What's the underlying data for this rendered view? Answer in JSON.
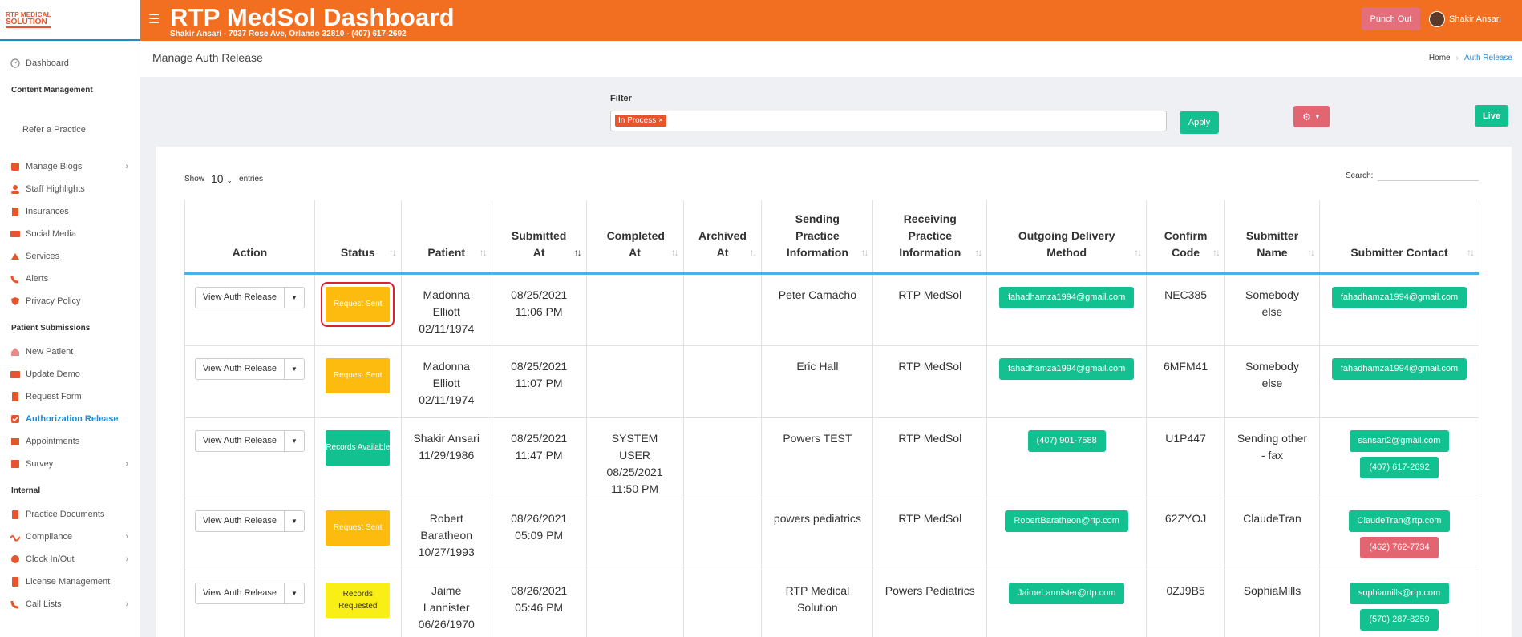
{
  "brand": {
    "logo_line1": "RTP MEDICAL",
    "logo_line2": "SOLUTION"
  },
  "header": {
    "title": "RTP MedSol Dashboard",
    "subtitle": "Shakir Ansari - 7037 Rose Ave, Orlando 32810 - (407) 617-2692",
    "punch_out": "Punch Out",
    "user_name": "Shakir Ansari"
  },
  "sidebar": {
    "dashboard": "Dashboard",
    "section_content": "Content Management",
    "refer": "Refer a Practice",
    "content_items": [
      "Manage Blogs",
      "Staff Highlights",
      "Insurances",
      "Social Media",
      "Services",
      "Alerts",
      "Privacy Policy"
    ],
    "section_patient": "Patient Submissions",
    "patient_items": [
      "New Patient",
      "Update Demo",
      "Request Form",
      "Authorization Release",
      "Appointments",
      "Survey"
    ],
    "section_internal": "Internal",
    "internal_items": [
      "Practice Documents",
      "Compliance",
      "Clock In/Out",
      "License Management",
      "Call Lists"
    ]
  },
  "page": {
    "title": "Manage Auth Release",
    "breadcrumb_home": "Home",
    "breadcrumb_current": "Auth Release"
  },
  "filter": {
    "label": "Filter",
    "chip": "In Process ×",
    "apply": "Apply",
    "live": "Live"
  },
  "table_controls": {
    "show": "Show",
    "entries_value": "10",
    "entries": "entries",
    "search": "Search:"
  },
  "columns": [
    "Action",
    "Status",
    "Patient",
    "Submitted At",
    "Completed At",
    "Archived At",
    "Sending Practice Information",
    "Receiving Practice Information",
    "Outgoing Delivery Method",
    "Confirm Code",
    "Submitter Name",
    "Submitter Contact"
  ],
  "action_label": "View Auth Release",
  "rows": [
    {
      "status": "Request Sent",
      "patient_name": "Madonna Elliott",
      "patient_dob": "02/11/1974",
      "submitted_date": "08/25/2021",
      "submitted_time": "11:06 PM",
      "completed": "",
      "sending": "Peter Camacho",
      "receiving": "RTP MedSol",
      "delivery": "fahadhamza1994@gmail.com",
      "code": "NEC385",
      "submitter": "Somebody else",
      "contact1": "fahadhamza1994@gmail.com",
      "contact2": ""
    },
    {
      "status": "Request Sent",
      "patient_name": "Madonna Elliott",
      "patient_dob": "02/11/1974",
      "submitted_date": "08/25/2021",
      "submitted_time": "11:07 PM",
      "completed": "",
      "sending": "Eric Hall",
      "receiving": "RTP MedSol",
      "delivery": "fahadhamza1994@gmail.com",
      "code": "6MFM41",
      "submitter": "Somebody else",
      "contact1": "fahadhamza1994@gmail.com",
      "contact2": ""
    },
    {
      "status": "Records Available",
      "patient_name": "Shakir Ansari",
      "patient_dob": "11/29/1986",
      "submitted_date": "08/25/2021",
      "submitted_time": "11:47 PM",
      "completed": "SYSTEM USER 08/25/2021 11:50 PM",
      "sending": "Powers TEST",
      "receiving": "RTP MedSol",
      "delivery": "(407) 901-7588",
      "code": "U1P447",
      "submitter": "Sending other - fax",
      "contact1": "sansari2@gmail.com",
      "contact2": "(407) 617-2692"
    },
    {
      "status": "Request Sent",
      "patient_name": "Robert Baratheon",
      "patient_dob": "10/27/1993",
      "submitted_date": "08/26/2021",
      "submitted_time": "05:09 PM",
      "completed": "",
      "sending": "powers pediatrics",
      "receiving": "RTP MedSol",
      "delivery": "RobertBaratheon@rtp.com",
      "code": "62ZYOJ",
      "submitter": "ClaudeTran",
      "contact1": "ClaudeTran@rtp.com",
      "contact2": "(462) 762-7734"
    },
    {
      "status": "Records Requested",
      "patient_name": "Jaime Lannister",
      "patient_dob": "06/26/1970",
      "submitted_date": "08/26/2021",
      "submitted_time": "05:46 PM",
      "completed": "",
      "sending": "RTP Medical Solution",
      "receiving": "Powers Pediatrics",
      "delivery": "JaimeLannister@rtp.com",
      "code": "0ZJ9B5",
      "submitter": "SophiaMills",
      "contact1": "sophiamills@rtp.com",
      "contact2": "(570) 287-8259"
    }
  ],
  "colors": {
    "brand_orange": "#f26f21",
    "accent_blue": "#1f8bd6",
    "green": "#12c18f",
    "red": "#e36572",
    "amber": "#fdbb10",
    "yellow": "#f9ef17"
  }
}
